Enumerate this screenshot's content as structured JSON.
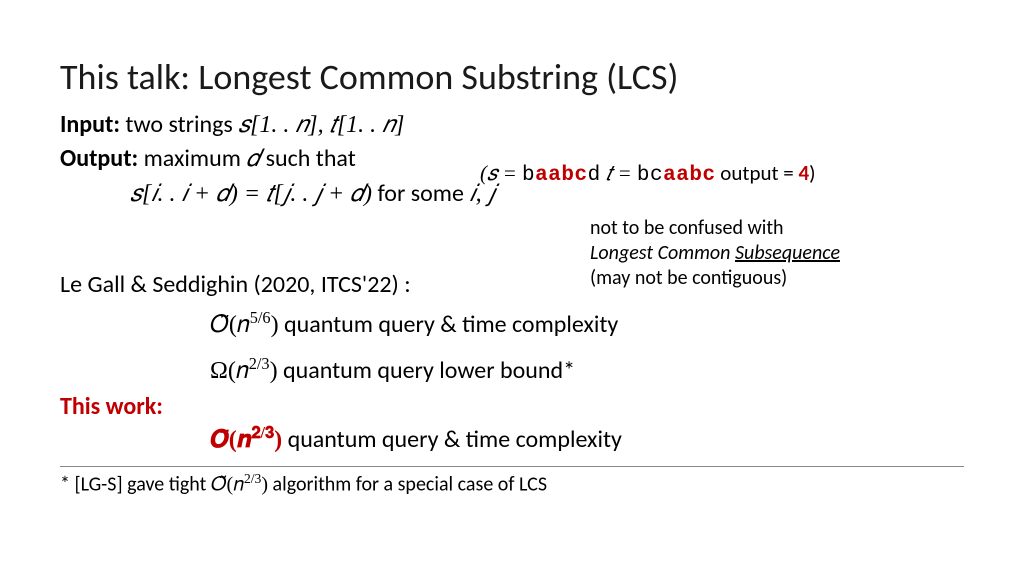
{
  "title": "This talk: Longest Common Substring (LCS)",
  "input_label": "Input:",
  "input_text": " two strings ",
  "input_math": "𝑠[1. . 𝑛], 𝑡[1. . 𝑛]",
  "output_label": "Output:",
  "output_text": " maximum ",
  "output_math": "𝑑",
  "output_text2": " such that",
  "equation": "𝑠[𝑖. . 𝑖 + 𝑑) = 𝑡[𝑗. . 𝑗 + 𝑑)",
  "equation_tail": " for some ",
  "equation_vars": "𝑖, 𝑗",
  "example_prefix": "(𝑠 = ",
  "example_s1": "b",
  "example_s2": "aabc",
  "example_s3": "d",
  "example_mid": "  𝑡 = ",
  "example_t1": "bc",
  "example_t2": "aabc",
  "example_suffix": " output = ",
  "example_val": "4",
  "example_close": ")",
  "note_l1": "not to be confused with",
  "note_l2a": " Longest Common ",
  "note_l2b": "Subsequence",
  "note_l3": "(may not be contiguous)",
  "citation": "Le Gall & Seddighin (2020, ITCS'22) :",
  "comp1_math": "𝑂̃(𝑛",
  "comp1_exp": "5/6",
  "comp1_paren": ")",
  "comp1_text": " quantum query & time complexity",
  "comp2_math": "Ω(𝑛",
  "comp2_exp": "2/3",
  "comp2_paren": ")",
  "comp2_text": " quantum query lower bound*",
  "thiswork": "This work:",
  "comp3_math": "𝑶̃(𝒏",
  "comp3_exp": "𝟐/𝟑",
  "comp3_paren": ")",
  "comp3_text": " quantum query & time complexity",
  "footnote_star": "* [LG-S] gave tight ",
  "footnote_math": "𝑂̃(𝑛",
  "footnote_exp": "2/3",
  "footnote_paren": ")",
  "footnote_tail": " algorithm for a special case of LCS"
}
